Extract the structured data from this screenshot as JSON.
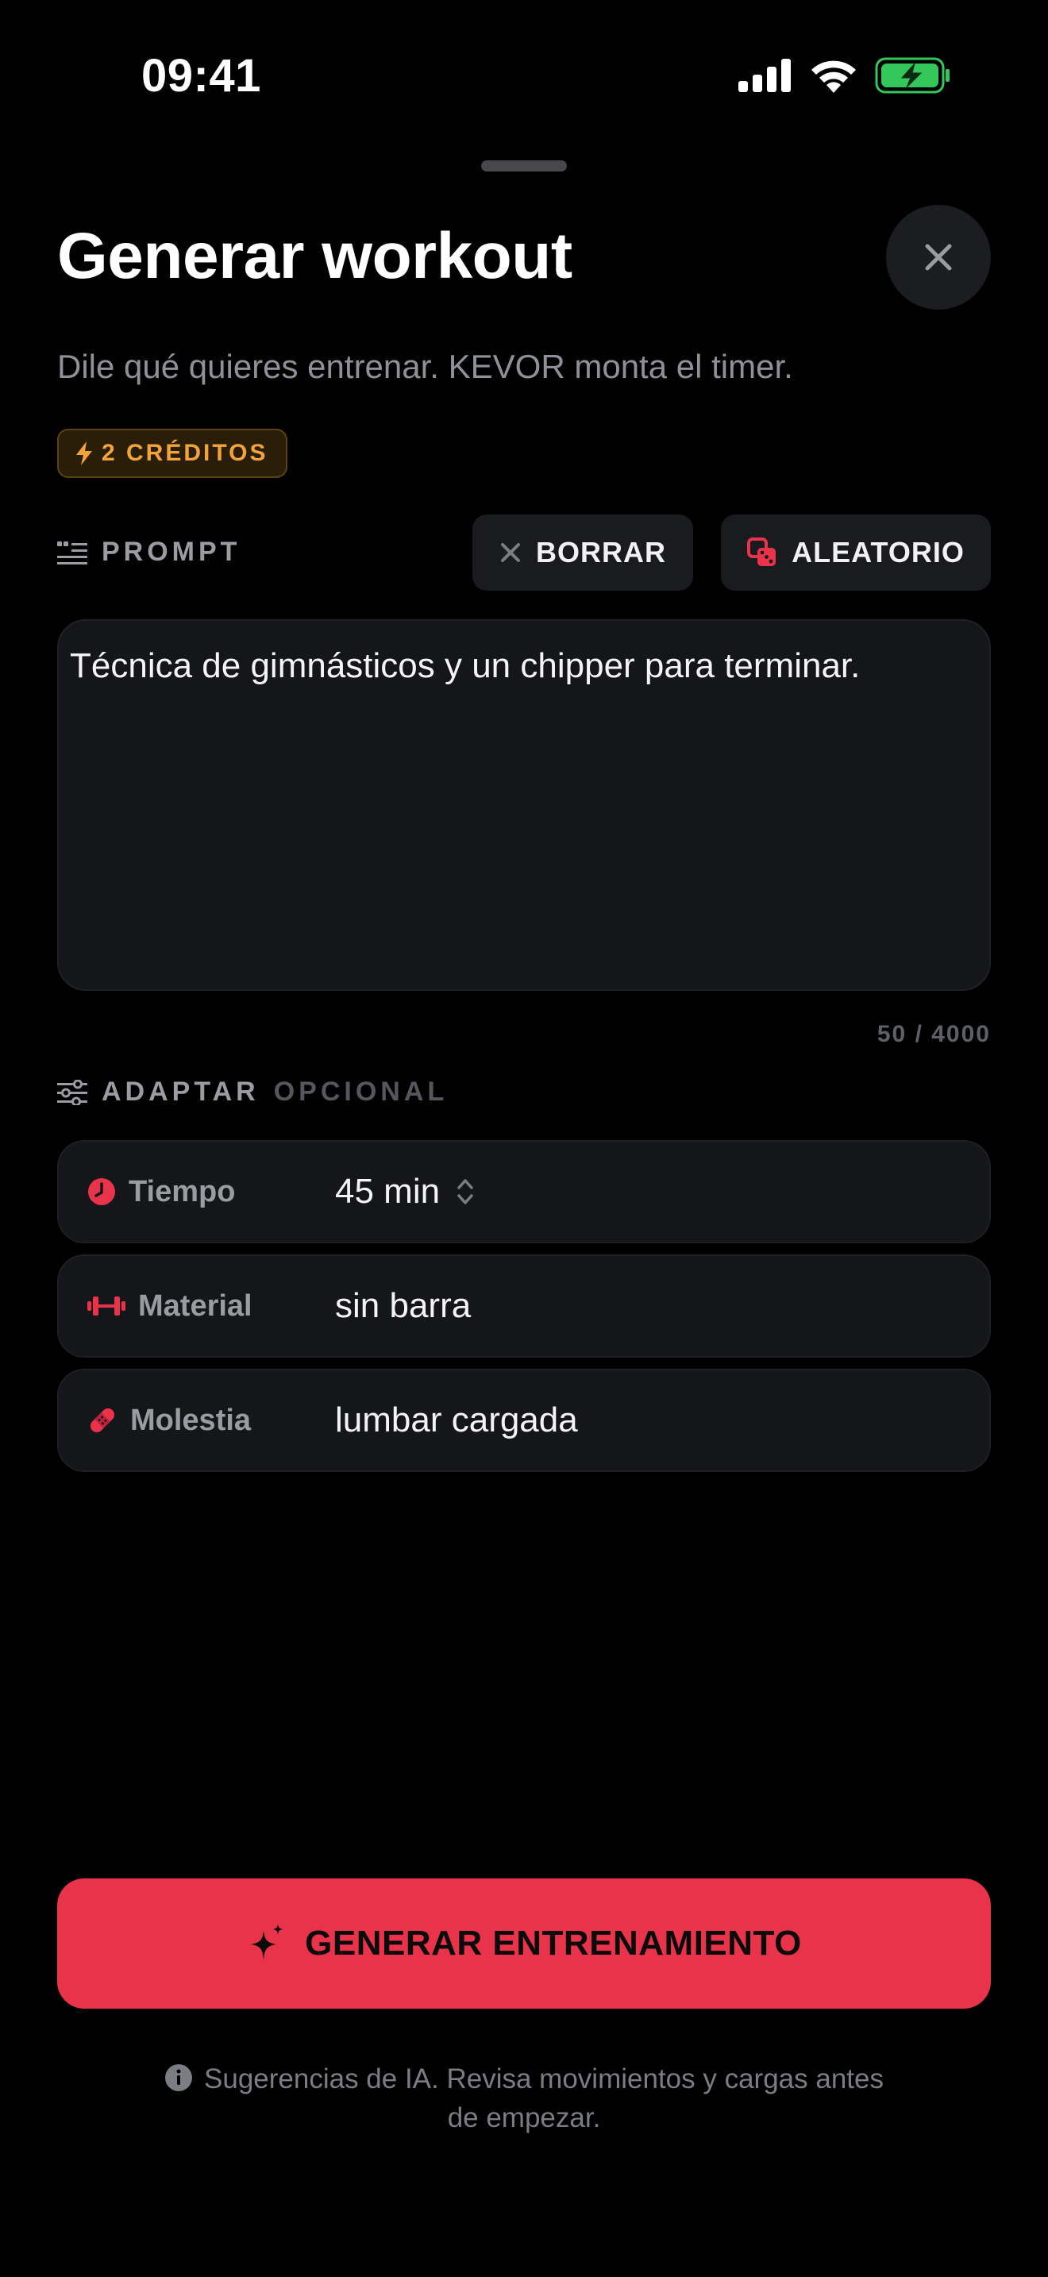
{
  "status_bar": {
    "time": "09:41",
    "icons": [
      "signal-icon",
      "wifi-icon",
      "battery-charging-icon"
    ]
  },
  "sheet": {
    "title": "Generar workout",
    "subtitle": "Dile qué quieres entrenar. KEVOR monta el timer.",
    "credits_badge": "2 CRÉDITOS",
    "close_icon": "close-icon"
  },
  "prompt": {
    "label": "PROMPT",
    "clear_label": "BORRAR",
    "random_label": "ALEATORIO",
    "text": "Técnica de gimnásticos y un chipper para terminar.",
    "counter": "50 / 4000"
  },
  "adapt": {
    "label": "ADAPTAR",
    "optional_label": "OPCIONAL",
    "rows": [
      {
        "label": "Tiempo",
        "value": "45 min",
        "icon": "clock-icon"
      },
      {
        "label": "Material",
        "value": "sin barra",
        "icon": "dumbbell-icon"
      },
      {
        "label": "Molestia",
        "value": "lumbar cargada",
        "icon": "bandage-icon"
      }
    ]
  },
  "cta": {
    "label": "GENERAR ENTRENAMIENTO",
    "icon": "sparkle-icon"
  },
  "disclaimer": "Sugerencias de IA. Revisa movimientos y cargas antes de empezar.",
  "colors": {
    "accent": "#e8334a",
    "credits": "#f2a43a",
    "battery": "#34c759",
    "background": "#000000"
  }
}
